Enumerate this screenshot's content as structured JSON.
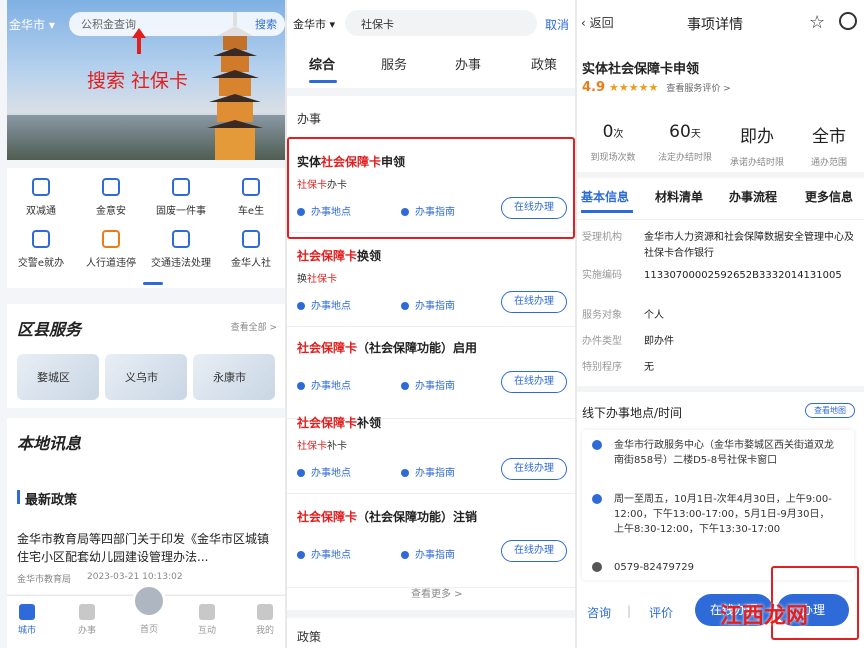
{
  "panel1": {
    "city": "金华市",
    "search_placeholder": "公积金查询",
    "search_btn": "搜索",
    "hero_annotation": "搜索 社保卡",
    "grid": [
      "双减通",
      "金意安",
      "固废一件事",
      "车e生",
      "交警e就办",
      "人行道违停",
      "交通违法处理",
      "金华人社"
    ],
    "district_title": "区县服务",
    "district_more": "查看全部 >",
    "districts": [
      "婺城区",
      "义乌市",
      "永康市"
    ],
    "news_section": "本地讯息",
    "policy_title": "最新政策",
    "news_text": "金华市教育局等四部门关于印发《金华市区城镇住宅小区配套幼儿园建设管理办法...",
    "news_source": "金华市教育局",
    "news_date": "2023-03-21 10:13:02",
    "tabs": [
      "城市",
      "办事",
      "首页",
      "互动",
      "我的"
    ]
  },
  "panel2": {
    "city": "金华市",
    "search_value": "社保卡",
    "cancel": "取消",
    "tabs": [
      "综合",
      "服务",
      "办事",
      "政策"
    ],
    "section": "办事",
    "see_more": "查看更多 >",
    "policy_section": "政策",
    "location_label": "办事地点",
    "guide_label": "办事指南",
    "online_label": "在线办理",
    "items": [
      {
        "pre": "实体",
        "hl": "社会保障卡",
        "post": "申领",
        "sub_hl": "社保卡",
        "sub_post": "办卡"
      },
      {
        "pre": "",
        "hl": "社会保障卡",
        "post": "换领",
        "sub_pre": "换",
        "sub_hl": "社保卡"
      },
      {
        "pre": "",
        "hl": "社会保障卡",
        "post": "（社会保障功能）启用"
      },
      {
        "pre": "",
        "hl": "社会保障卡",
        "post": "补领",
        "sub_hl": "社保卡",
        "sub_post": "补卡"
      },
      {
        "pre": "",
        "hl": "社会保障卡",
        "post": "（社会保障功能）注销"
      }
    ]
  },
  "panel3": {
    "back": "返回",
    "title": "事项详情",
    "item_name": "实体社会保障卡申领",
    "rating": "4.9",
    "stars": "★★★★★",
    "eval_link": "查看服务评价 >",
    "stats": [
      {
        "v": "0",
        "u": "次",
        "l": "到现场次数"
      },
      {
        "v": "60",
        "u": "天",
        "l": "法定办结时限"
      },
      {
        "v": "即办",
        "u": "",
        "l": "承诺办结时限"
      },
      {
        "v": "全市",
        "u": "",
        "l": "通办范围"
      }
    ],
    "tabs": [
      "基本信息",
      "材料清单",
      "办事流程",
      "更多信息"
    ],
    "rows": [
      {
        "k": "受理机构",
        "v": "金华市人力资源和社会保障数据安全管理中心及社保卡合作银行"
      },
      {
        "k": "实施编码",
        "v": "11330700002592652B3332014131005"
      },
      {
        "k": "服务对象",
        "v": "个人"
      },
      {
        "k": "办件类型",
        "v": "即办件"
      },
      {
        "k": "特别程序",
        "v": "无"
      }
    ],
    "offline_title": "线下办事地点/时间",
    "map_btn": "查看地图",
    "address": "金华市行政服务中心（金华市婺城区西关街道双龙南街858号）二楼D5-8号社保卡窗口",
    "hours": "周一至周五，10月1日-次年4月30日，上午9:00-12:00，下午13:00-17:00，5月1日-9月30日，上午8:30-12:00，下午13:30-17:00",
    "phone": "0579-82479729",
    "consult": "咨询",
    "divider": "|",
    "evaluate": "评价",
    "online_btn": "在线办理",
    "handle_btn": "办理"
  },
  "watermark": "江西龙网",
  "colors": {
    "accent": "#2f6bd8",
    "highlight": "#e02020"
  }
}
